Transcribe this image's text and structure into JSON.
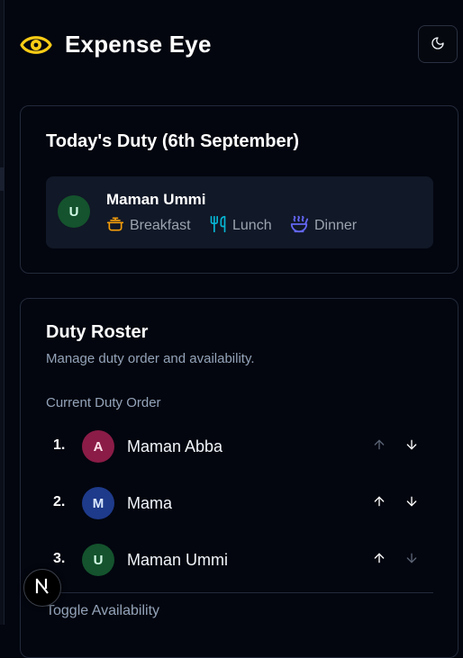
{
  "app": {
    "title": "Expense Eye",
    "brand_icon": "eye-icon",
    "theme_toggle_icon": "moon-icon"
  },
  "today": {
    "title": "Today's Duty (6th September)",
    "assignee": {
      "initial": "U",
      "name": "Maman Ummi",
      "avatar_color": "#14532d"
    },
    "meals": [
      {
        "label": "Breakfast",
        "icon": "pot-icon",
        "color": "#f59e0b"
      },
      {
        "label": "Lunch",
        "icon": "utensils-icon",
        "color": "#06b6d4"
      },
      {
        "label": "Dinner",
        "icon": "soup-bowl-icon",
        "color": "#6366f1"
      }
    ]
  },
  "roster": {
    "title": "Duty Roster",
    "subtitle": "Manage duty order and availability.",
    "order_heading": "Current Duty Order",
    "members": [
      {
        "number": "1.",
        "initial": "A",
        "name": "Maman Abba",
        "avatar_color": "#8b1c47",
        "up_enabled": false,
        "down_enabled": true
      },
      {
        "number": "2.",
        "initial": "M",
        "name": "Mama",
        "avatar_color": "#1e3a8a",
        "up_enabled": true,
        "down_enabled": true
      },
      {
        "number": "3.",
        "initial": "U",
        "name": "Maman Ummi",
        "avatar_color": "#14532d",
        "up_enabled": true,
        "down_enabled": false
      }
    ],
    "availability_heading": "Toggle Availability"
  },
  "dev_badge": {
    "letter": "N"
  },
  "colors": {
    "background": "#03060f",
    "card_border": "#232a3a",
    "brand_yellow": "#facc15",
    "muted_text": "#94a3b8"
  }
}
